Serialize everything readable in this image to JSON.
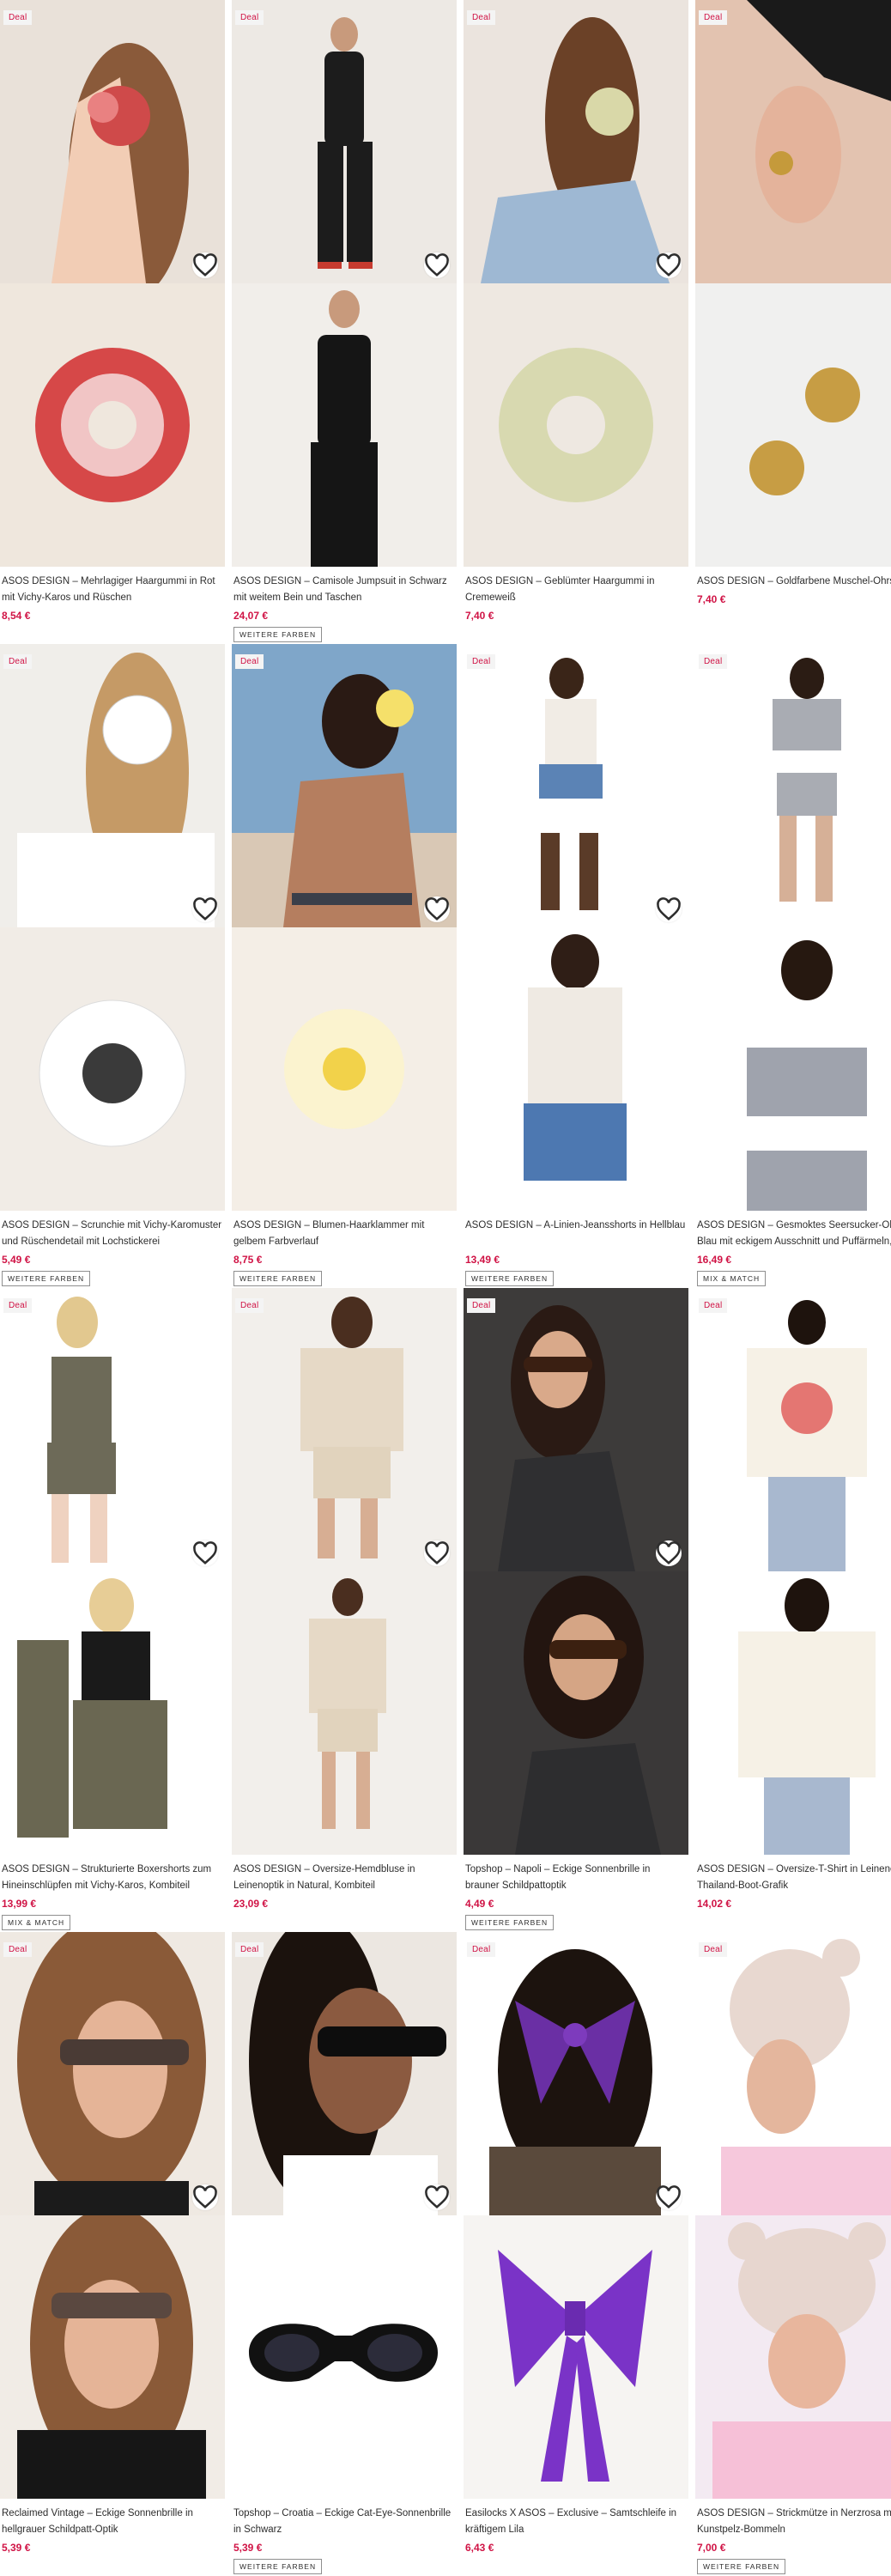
{
  "labels": {
    "deal": "Deal"
  },
  "colors": {
    "price": "#d01345",
    "badge_text": "#d01345"
  },
  "products": [
    {
      "title": "ASOS DESIGN – Mehrlagiger Haargummi in Rot mit Vichy-Karos und Rüschen",
      "price": "8,54 €",
      "tag": ""
    },
    {
      "title": "ASOS DESIGN – Camisole Jumpsuit in Schwarz mit weitem Bein und Taschen",
      "price": "24,07 €",
      "tag": "WEITERE FARBEN"
    },
    {
      "title": "ASOS DESIGN – Geblümter Haargummi in Cremeweiß",
      "price": "7,40 €",
      "tag": ""
    },
    {
      "title": "ASOS DESIGN – Goldfarbene Muschel-Ohrste",
      "price": "7,40 €",
      "tag": ""
    },
    {
      "title": "ASOS DESIGN – Scrunchie mit Vichy-Karomuster und Rüschendetail mit Lochstickerei",
      "price": "5,49 €",
      "tag": "WEITERE FARBEN"
    },
    {
      "title": "ASOS DESIGN – Blumen-Haarklammer mit gelbem Farbverlauf",
      "price": "8,75 €",
      "tag": "WEITERE FARBEN"
    },
    {
      "title": "ASOS DESIGN – A-Linien-Jeansshorts in Hellblau",
      "price": "13,49 €",
      "tag": "WEITERE FARBEN"
    },
    {
      "title": "ASOS DESIGN – Gesmoktes Seersucker-Ober Blau mit eckigem Ausschnitt und Puffärmeln,...",
      "price": "16,49 €",
      "tag": "MIX & MATCH"
    },
    {
      "title": "ASOS DESIGN – Strukturierte Boxershorts zum Hineinschlüpfen mit Vichy-Karos, Kombiteil",
      "price": "13,99 €",
      "tag": "MIX & MATCH"
    },
    {
      "title": "ASOS DESIGN – Oversize-Hemdbluse in Leinenoptik in Natural, Kombiteil",
      "price": "23,09 €",
      "tag": ""
    },
    {
      "title": "Topshop – Napoli – Eckige Sonnenbrille in brauner Schildpattoptik",
      "price": "4,49 €",
      "tag": "WEITERE FARBEN"
    },
    {
      "title": "ASOS DESIGN – Oversize-T-Shirt in Leinenopt Thailand-Boot-Grafik",
      "price": "14,02 €",
      "tag": ""
    },
    {
      "title": "Reclaimed Vintage – Eckige Sonnenbrille in hellgrauer Schildpatt-Optik",
      "price": "5,39 €",
      "tag": ""
    },
    {
      "title": "Topshop – Croatia – Eckige Cat-Eye-Sonnenbrille in Schwarz",
      "price": "5,39 €",
      "tag": "WEITERE FARBEN"
    },
    {
      "title": "Easilocks X ASOS – Exclusive – Samtschleife in kräftigem Lila",
      "price": "6,43 €",
      "tag": ""
    },
    {
      "title": "ASOS DESIGN – Strickmütze in Nerzrosa mit Kunstpelz-Bommeln",
      "price": "7,00 €",
      "tag": "WEITERE FARBEN"
    }
  ]
}
